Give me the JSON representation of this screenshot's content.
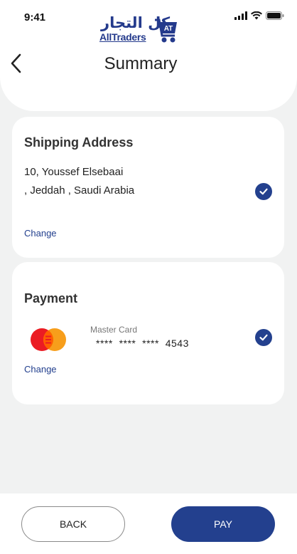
{
  "status_bar": {
    "time": "9:41"
  },
  "logo": {
    "arabic": "كل التجار",
    "english": "AllTraders",
    "badge": "AT"
  },
  "header": {
    "title": "Summary"
  },
  "shipping": {
    "title": "Shipping Address",
    "line1": "10, Youssef Elsebaai",
    "line2": ", Jeddah , Saudi Arabia",
    "change_label": "Change"
  },
  "payment": {
    "title": "Payment",
    "card_type": "Master Card",
    "card_number": "****  ****  ****  4543",
    "change_label": "Change"
  },
  "footer": {
    "back_label": "BACK",
    "pay_label": "PAY"
  },
  "colors": {
    "accent": "#23408e",
    "background": "#f1f2f2",
    "mc_red": "#eb1c23",
    "mc_yellow": "#f79e1b"
  }
}
